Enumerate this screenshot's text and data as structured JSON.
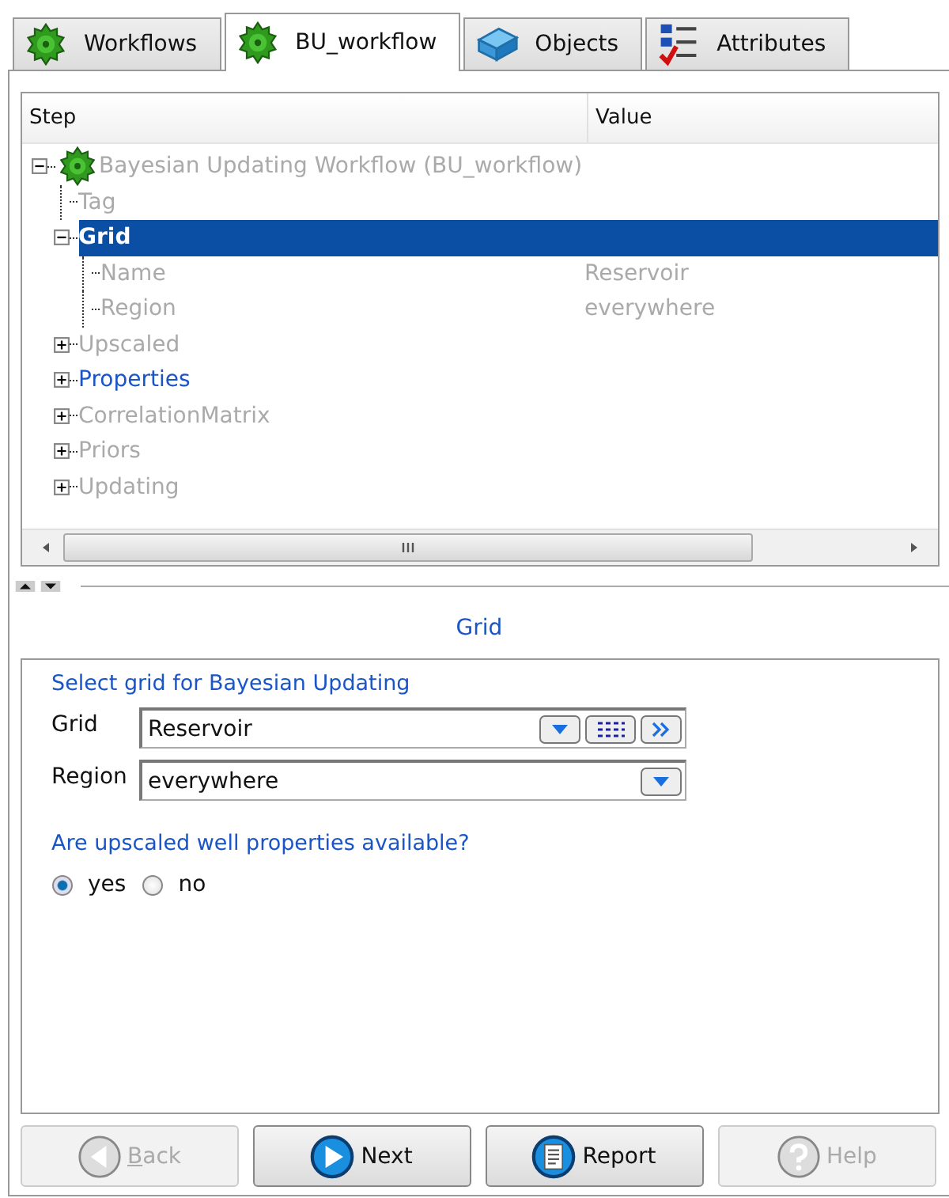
{
  "tabs": [
    {
      "label": "Workflows",
      "kind": "gear",
      "selected": false
    },
    {
      "label": "BU_workflow",
      "kind": "gear",
      "selected": true
    },
    {
      "label": "Objects",
      "kind": "block",
      "selected": false
    },
    {
      "label": "Attributes",
      "kind": "checklist",
      "selected": false
    }
  ],
  "tree": {
    "columns": [
      "Step",
      "Value"
    ],
    "items": [
      {
        "label": "Bayesian Updating Workflow (BU_workflow)",
        "kind": "gear",
        "enabled": false,
        "selected": false,
        "expanded": true,
        "children": [
          {
            "label": "Tag",
            "enabled": false,
            "selected": false
          },
          {
            "label": "Grid",
            "enabled": true,
            "selected": true,
            "expanded": true,
            "children": [
              {
                "label": "Name",
                "value": "Reservoir",
                "enabled": false,
                "selected": false
              },
              {
                "label": "Region",
                "value": "everywhere",
                "enabled": false,
                "selected": false
              }
            ]
          },
          {
            "label": "Upscaled",
            "enabled": false,
            "selected": false,
            "expanded": false
          },
          {
            "label": "Properties",
            "enabled": true,
            "selected": false,
            "expanded": false
          },
          {
            "label": "CorrelationMatrix",
            "enabled": false,
            "selected": false,
            "expanded": false
          },
          {
            "label": "Priors",
            "enabled": false,
            "selected": false,
            "expanded": false
          },
          {
            "label": "Updating",
            "enabled": false,
            "selected": false,
            "expanded": false
          }
        ]
      }
    ]
  },
  "section_title": "Grid",
  "form": {
    "heading": "Select grid for Bayesian Updating",
    "fields": [
      {
        "label": "Grid",
        "value": "Reservoir",
        "extra_buttons": true
      },
      {
        "label": "Region",
        "value": "everywhere",
        "extra_buttons": false
      }
    ],
    "question": "Are upscaled well properties available?",
    "options": [
      {
        "label": "yes",
        "selected": true
      },
      {
        "label": "no",
        "selected": false
      }
    ]
  },
  "buttons": [
    {
      "label": "Back",
      "kind": "back",
      "disabled": true
    },
    {
      "label": "Next",
      "kind": "next",
      "disabled": false
    },
    {
      "label": "Report",
      "kind": "report",
      "disabled": false
    },
    {
      "label": "Help",
      "kind": "help",
      "disabled": true
    }
  ]
}
